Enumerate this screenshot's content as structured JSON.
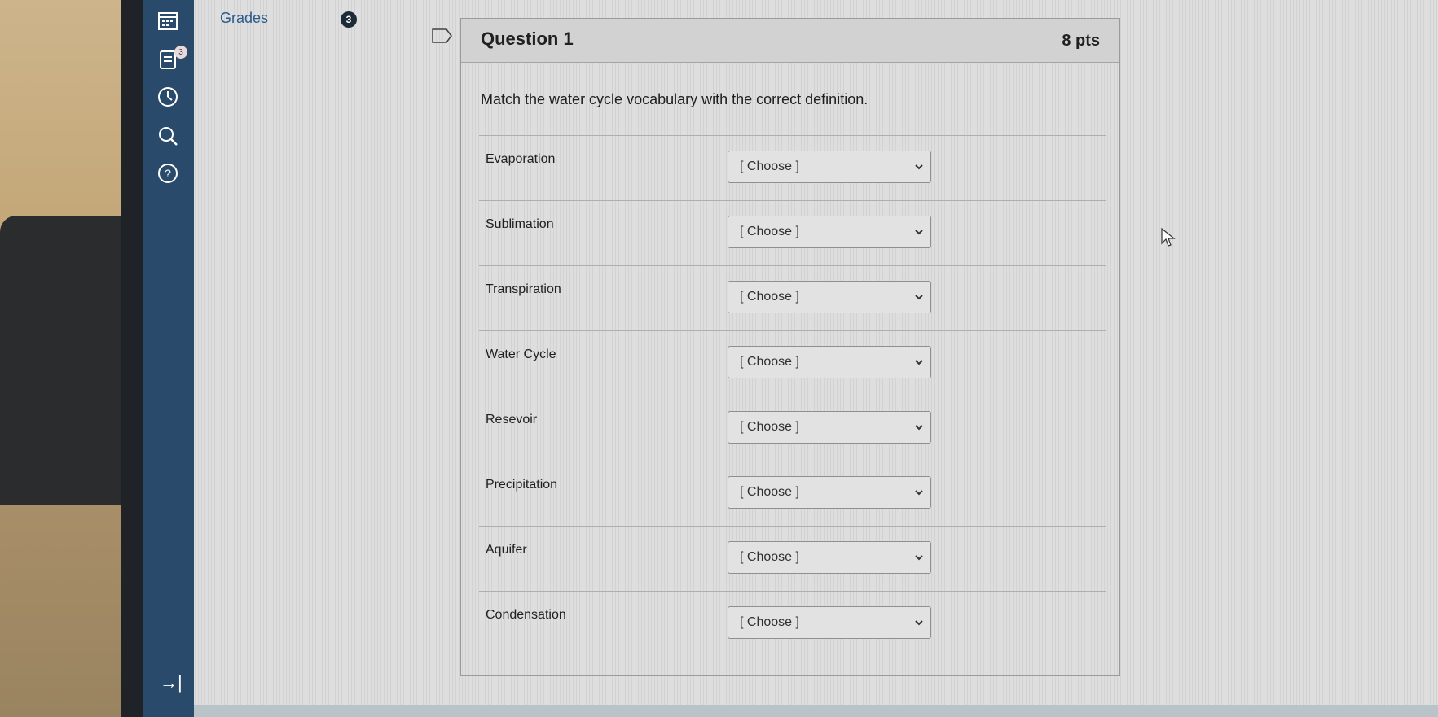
{
  "subnav": {
    "grades_label": "Grades",
    "grades_badge": "3"
  },
  "nav": {
    "inbox_badge": "3",
    "collapse_icon": "→|"
  },
  "question": {
    "title": "Question 1",
    "points": "8 pts",
    "prompt": "Match the water cycle vocabulary with the correct definition.",
    "items": [
      {
        "term": "Evaporation",
        "selected": "[ Choose ]"
      },
      {
        "term": "Sublimation",
        "selected": "[ Choose ]"
      },
      {
        "term": "Transpiration",
        "selected": "[ Choose ]"
      },
      {
        "term": "Water Cycle",
        "selected": "[ Choose ]"
      },
      {
        "term": "Resevoir",
        "selected": "[ Choose ]"
      },
      {
        "term": "Precipitation",
        "selected": "[ Choose ]"
      },
      {
        "term": "Aquifer",
        "selected": "[ Choose ]"
      },
      {
        "term": "Condensation",
        "selected": "[ Choose ]"
      }
    ]
  }
}
